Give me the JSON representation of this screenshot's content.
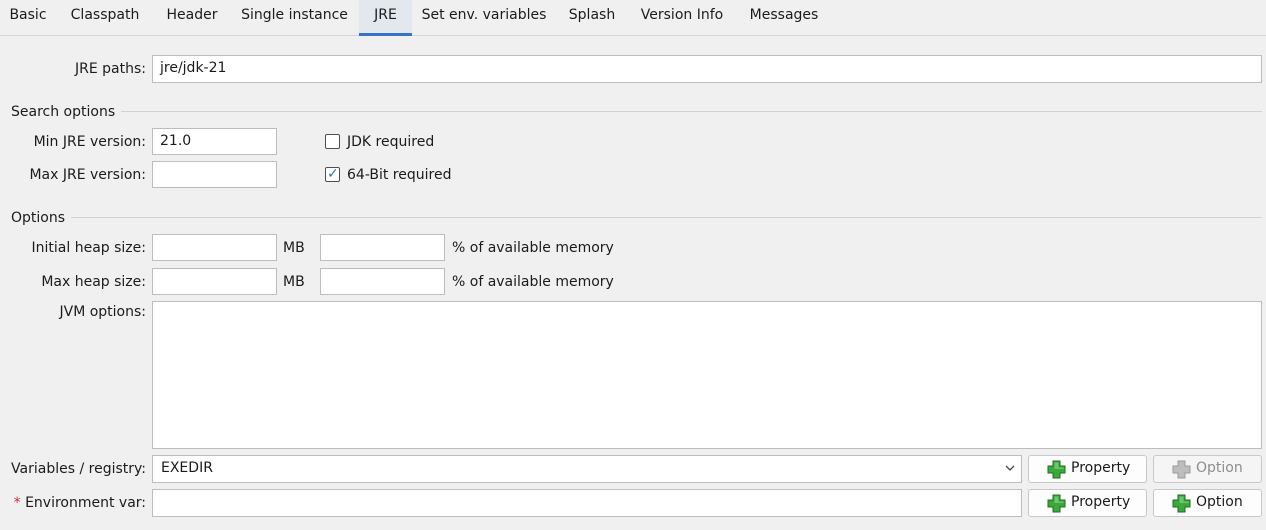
{
  "tabs": [
    {
      "label": "Basic"
    },
    {
      "label": "Classpath"
    },
    {
      "label": "Header"
    },
    {
      "label": "Single instance"
    },
    {
      "label": "JRE"
    },
    {
      "label": "Set env. variables"
    },
    {
      "label": "Splash"
    },
    {
      "label": "Version Info"
    },
    {
      "label": "Messages"
    }
  ],
  "active_tab": "JRE",
  "jre_paths": {
    "label": "JRE paths:",
    "value": "jre/jdk-21"
  },
  "search_options": {
    "title": "Search options",
    "min_label": "Min JRE version:",
    "min_value": "21.0",
    "max_label": "Max JRE version:",
    "max_value": "",
    "jdk_required_label": "JDK required",
    "jdk_required_checked": false,
    "bit64_label": "64-Bit required",
    "bit64_checked": true
  },
  "options": {
    "title": "Options",
    "initial_heap_label": "Initial heap size:",
    "initial_heap_value": "",
    "initial_heap_unit": "MB",
    "initial_heap_percent": "",
    "initial_heap_percent_label": "% of available memory",
    "max_heap_label": "Max heap size:",
    "max_heap_value": "",
    "max_heap_unit": "MB",
    "max_heap_percent": "",
    "max_heap_percent_label": "% of available memory",
    "jvm_label": "JVM options:",
    "jvm_value": ""
  },
  "variables": {
    "label": "Variables / registry:",
    "selected": "EXEDIR",
    "property_button": "Property",
    "option_button": "Option"
  },
  "envvar": {
    "required_mark": "*",
    "label": "Environment var:",
    "value": "",
    "property_button": "Property",
    "option_button": "Option"
  },
  "colors": {
    "accent": "#3574c4",
    "checkmark": "#2f6fc1",
    "required": "#d22a2a",
    "plus_icon": "#3aa83a"
  }
}
